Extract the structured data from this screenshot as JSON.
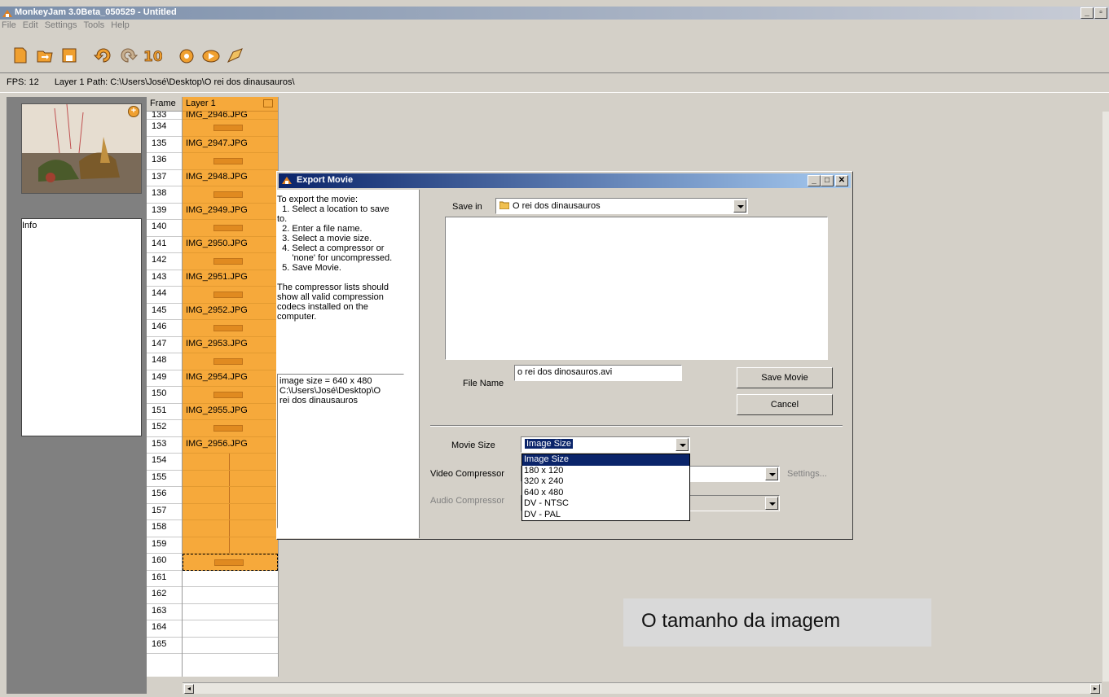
{
  "window": {
    "title": "MonkeyJam 3.0Beta_050529 - Untitled"
  },
  "menu": [
    "File",
    "Edit",
    "Settings",
    "Tools",
    "Help"
  ],
  "toolbar_icons": [
    "new-icon",
    "open-icon",
    "save-icon",
    "undo-icon",
    "redo-icon",
    "ten-frames-icon",
    "capture-icon",
    "play-icon",
    "export-icon"
  ],
  "status": {
    "fps": "FPS: 12",
    "layer_path": "Layer 1 Path: C:\\Users\\José\\Desktop\\O rei dos dinausauros\\"
  },
  "left_panel": {
    "info_label": "Info"
  },
  "xsheet": {
    "frame_header": "Frame",
    "layer_header": "Layer 1",
    "frames": [
      "133",
      "134",
      "135",
      "136",
      "137",
      "138",
      "139",
      "140",
      "141",
      "142",
      "143",
      "144",
      "145",
      "146",
      "147",
      "148",
      "149",
      "150",
      "151",
      "152",
      "153",
      "154",
      "155",
      "156",
      "157",
      "158",
      "159",
      "160",
      "161",
      "162",
      "163",
      "164",
      "165"
    ],
    "cells": [
      "IMG_2946.JPG",
      "",
      "IMG_2947.JPG",
      "",
      "IMG_2948.JPG",
      "",
      "IMG_2949.JPG",
      "",
      "IMG_2950.JPG",
      "",
      "IMG_2951.JPG",
      "",
      "IMG_2952.JPG",
      "",
      "IMG_2953.JPG",
      "",
      "IMG_2954.JPG",
      "",
      "IMG_2955.JPG",
      "",
      "IMG_2956.JPG",
      "",
      "",
      "",
      "",
      "",
      "",
      "",
      "",
      "",
      "",
      "",
      ""
    ]
  },
  "dialog": {
    "title": "Export Movie",
    "instructions": "To export the movie:\n  1. Select a location to save\nto.\n  2. Enter a file name.\n  3. Select a movie size.\n  4. Select a compressor or\n      'none' for uncompressed.\n  5. Save Movie.\n\nThe compressor lists should\nshow all valid compression\ncodecs installed on the\ncomputer.",
    "info_text": "image size = 640 x 480\nC:\\Users\\José\\Desktop\\O\nrei dos dinausauros",
    "save_in_label": "Save in",
    "save_in_value": "O rei dos dinausauros",
    "file_name_label": "File Name",
    "file_name_value": "o rei dos dinosauros.avi",
    "save_button": "Save Movie",
    "cancel_button": "Cancel",
    "movie_size_label": "Movie Size",
    "movie_size_value": "Image Size",
    "video_compressor_label": "Video Compressor",
    "audio_compressor_label": "Audio Compressor",
    "settings_label": "Settings...",
    "movie_size_options": [
      "Image Size",
      "180 x 120",
      "320 x 240",
      "640 x 480",
      "DV - NTSC",
      "DV - PAL"
    ]
  },
  "callout": {
    "text": "O tamanho da imagem"
  },
  "colors": {
    "layer_orange": "#f6a93b",
    "selection_blue": "#0a246a",
    "window_bg": "#d4d0c8"
  }
}
